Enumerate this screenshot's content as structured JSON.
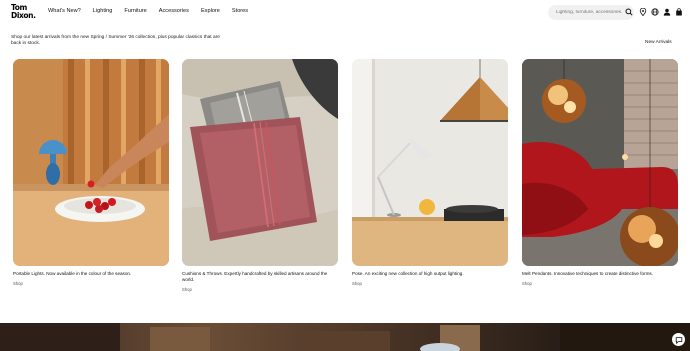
{
  "brand": {
    "logo_line1": "Tom",
    "logo_line2": "Dixon."
  },
  "nav": {
    "items": [
      "What's New?",
      "Lighting",
      "Furniture",
      "Accessories",
      "Explore",
      "Stores"
    ]
  },
  "search": {
    "placeholder": "Lighting, furniture, accessories..."
  },
  "header_icons": [
    "search-icon",
    "location-icon",
    "globe-icon",
    "user-icon",
    "bag-icon"
  ],
  "intro": {
    "text": "Shop our latest arrivals from the new Spring / Summer '26 collection, plus popular classics that are back in stock."
  },
  "new_arrivals_link": "New Arrivals",
  "cards": [
    {
      "caption": "Portable Lights. Now available in the colour of the season.",
      "shop": "Shop"
    },
    {
      "caption": "Cushions & Throws. Expertly handcrafted by skilled artisans around the world.",
      "shop": "Shop"
    },
    {
      "caption": "Pose. An exciting new collection of high output lighting.",
      "shop": "Shop"
    },
    {
      "caption": "Melt Pendants. Innovative techniques to create distinctive forms.",
      "shop": "Shop"
    }
  ]
}
